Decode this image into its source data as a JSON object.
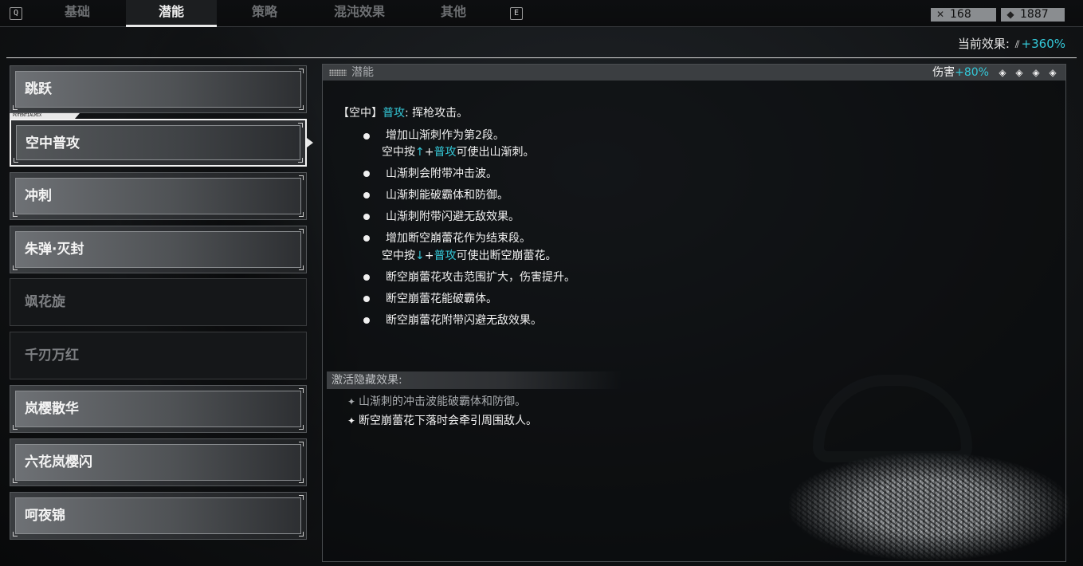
{
  "topbar": {
    "key_prev": "Q",
    "key_next": "E",
    "tabs": [
      {
        "label": "基础"
      },
      {
        "label": "潜能"
      },
      {
        "label": "策略"
      },
      {
        "label": "混沌效果"
      },
      {
        "label": "其他"
      }
    ],
    "active_tab": "潜能",
    "currency_1": {
      "icon": "crossed-swords-icon",
      "value": "168"
    },
    "currency_2": {
      "icon": "gem-icon",
      "value": "1887"
    }
  },
  "current_effect": {
    "label": "当前效果:",
    "icon": "slash-effect-icon",
    "value": "+360%"
  },
  "skills": [
    {
      "label": "跳跃",
      "state": "unlocked"
    },
    {
      "label": "空中普攻",
      "state": "selected"
    },
    {
      "label": "冲刺",
      "state": "unlocked"
    },
    {
      "label": "朱弹·灭封",
      "state": "unlocked"
    },
    {
      "label": "飒花旋",
      "state": "locked"
    },
    {
      "label": "千刃万红",
      "state": "locked"
    },
    {
      "label": "岚樱散华",
      "state": "unlocked"
    },
    {
      "label": "六花岚樱闪",
      "state": "unlocked"
    },
    {
      "label": "呵夜锦",
      "state": "unlocked"
    }
  ],
  "selected_tag": "POTENTIALMIX",
  "panel": {
    "title": "潜能",
    "stat_label": "伤害",
    "stat_value": "+80%",
    "level_diamonds": 4,
    "intro": {
      "prefix": "【空中】",
      "keyword": "普攻",
      "suffix": ": 挥枪攻击。"
    },
    "bullets": [
      {
        "line1": "增加山渐刺作为第2段。",
        "line2_pre": "空中按",
        "line2_arrow": "↑",
        "line2_plus": "+",
        "line2_key": "普攻",
        "line2_post": "可使出山渐刺。"
      },
      {
        "line1": "山渐刺会附带冲击波。"
      },
      {
        "line1": "山渐刺能破霸体和防御。"
      },
      {
        "line1": "山渐刺附带闪避无敌效果。"
      },
      {
        "line1": "增加断空崩蕾花作为结束段。",
        "line2_pre": "空中按",
        "line2_arrow": "↓",
        "line2_plus": "+",
        "line2_key": "普攻",
        "line2_post": "可使出断空崩蕾花。"
      },
      {
        "line1": "断空崩蕾花攻击范围扩大，伤害提升。"
      },
      {
        "line1": "断空崩蕾花能破霸体。"
      },
      {
        "line1": "断空崩蕾花附带闪避无敌效果。"
      }
    ],
    "hidden": {
      "title": "激活隐藏效果:",
      "items": [
        {
          "text": "山渐刺的冲击波能破霸体和防御。",
          "active": false
        },
        {
          "text": "断空崩蕾花下落时会牵引周围敌人。",
          "active": true
        }
      ]
    }
  },
  "colors": {
    "accent": "#34c8d8",
    "text": "#f0f0f0",
    "muted": "#7d7f82"
  }
}
